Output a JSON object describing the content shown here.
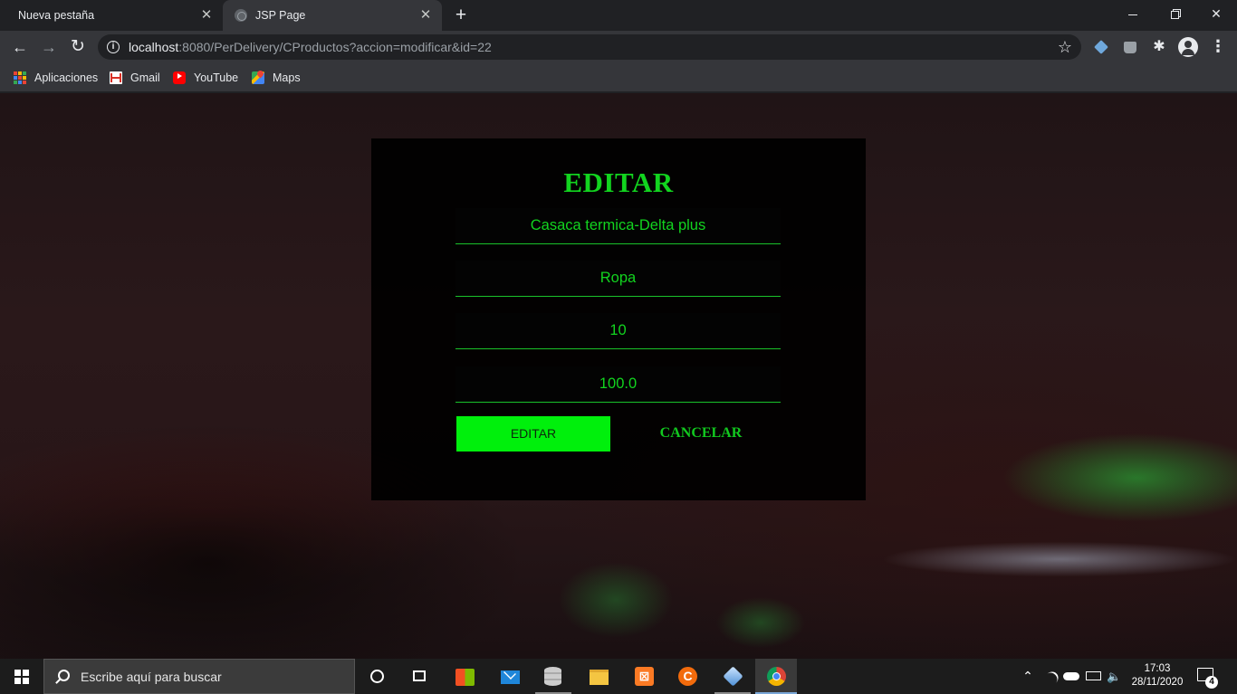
{
  "browser": {
    "tabs": [
      {
        "title": "Nueva pestaña",
        "active": false
      },
      {
        "title": "JSP Page",
        "active": true
      }
    ],
    "url_host": "localhost",
    "url_rest": ":8080/PerDelivery/CProductos?accion=modificar&id=22",
    "bookmarks": [
      {
        "label": "Aplicaciones",
        "icon": "apps-grid-icon"
      },
      {
        "label": "Gmail",
        "icon": "gmail-icon"
      },
      {
        "label": "YouTube",
        "icon": "youtube-icon"
      },
      {
        "label": "Maps",
        "icon": "maps-icon"
      }
    ]
  },
  "form": {
    "title": "EDITAR",
    "fields": {
      "nombre": "Casaca termica-Delta plus",
      "categoria": "Ropa",
      "stock": "10",
      "precio": "100.0"
    },
    "submit_label": "EDITAR",
    "cancel_label": "CANCELAR",
    "colors": {
      "accent": "#12d41f",
      "button": "#00f00c",
      "panel": "#000000"
    }
  },
  "taskbar": {
    "search_placeholder": "Escribe aquí para buscar",
    "time": "17:03",
    "date": "28/11/2020",
    "notification_count": "4"
  }
}
